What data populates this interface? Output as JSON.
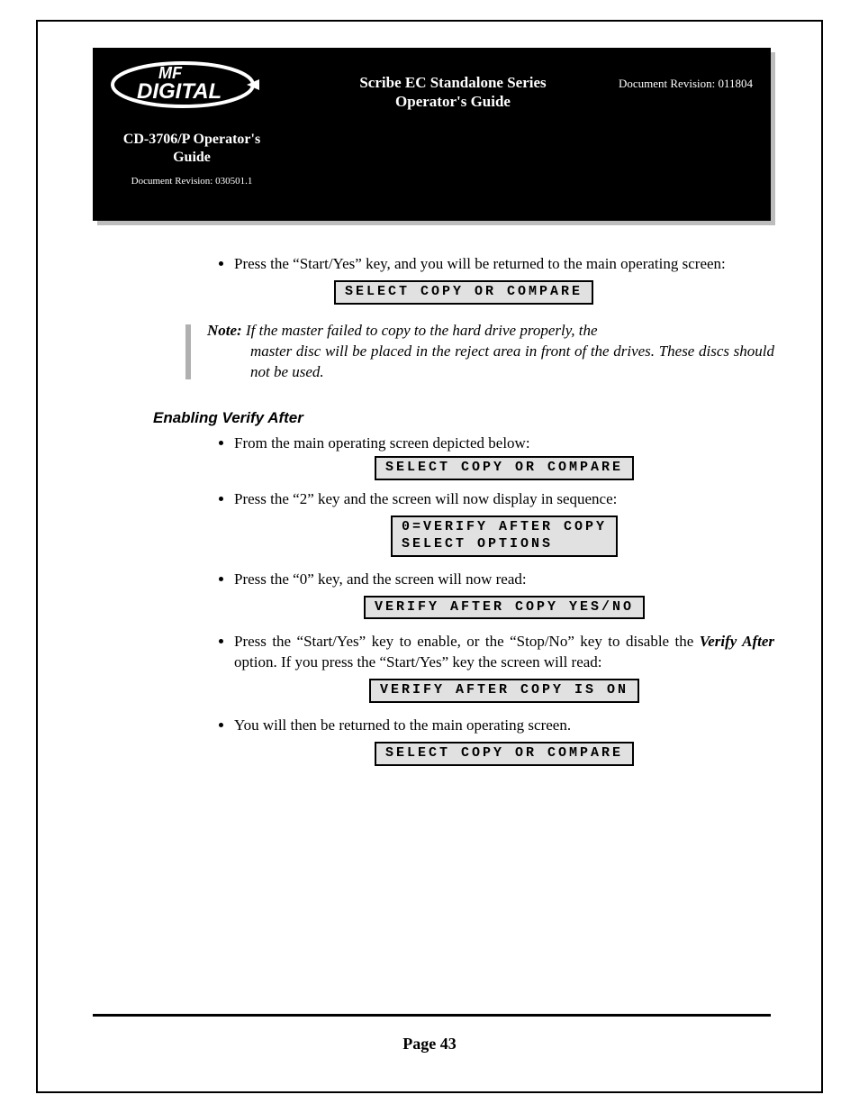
{
  "header": {
    "logo_text_top": "MF",
    "logo_text_bottom": "DIGITAL",
    "center_line1": "Scribe EC Standalone Series",
    "center_line2": "Operator's Guide",
    "right_rev": "Document Revision: 011804",
    "sub_title_line1": "CD-3706/P Operator's",
    "sub_title_line2": "Guide",
    "sub_rev": "Document Revision: 030501.1"
  },
  "body": {
    "bullet1": "Press the “Start/Yes” key, and you will be returned to the main operating screen:",
    "lcd1": "SELECT COPY OR COMPARE",
    "note_label": "Note:",
    "note_first": " If the master failed to copy to the hard drive properly, the",
    "note_rest": "master disc will be placed in the reject area in front of the drives. These discs should not be used.",
    "section_heading": "Enabling Verify After",
    "bullet2": "From the main operating screen depicted below:",
    "lcd2": "SELECT COPY OR COMPARE",
    "bullet3": "Press the “2” key and the screen will now display in sequence:",
    "lcd3": "0=VERIFY AFTER COPY\nSELECT OPTIONS",
    "bullet4": "Press the “0” key, and the screen will now read:",
    "lcd4": "VERIFY AFTER COPY YES/NO",
    "bullet5_a": "Press the “Start/Yes” key to enable, or the “Stop/No” key to disable the ",
    "bullet5_em": "Verify After",
    "bullet5_b": " option. If you press the “Start/Yes” key the screen will read:",
    "lcd5": "VERIFY AFTER COPY IS ON",
    "bullet6": "You will then be returned to the main operating screen.",
    "lcd6": "SELECT COPY OR COMPARE"
  },
  "footer": {
    "page": "Page 43"
  }
}
